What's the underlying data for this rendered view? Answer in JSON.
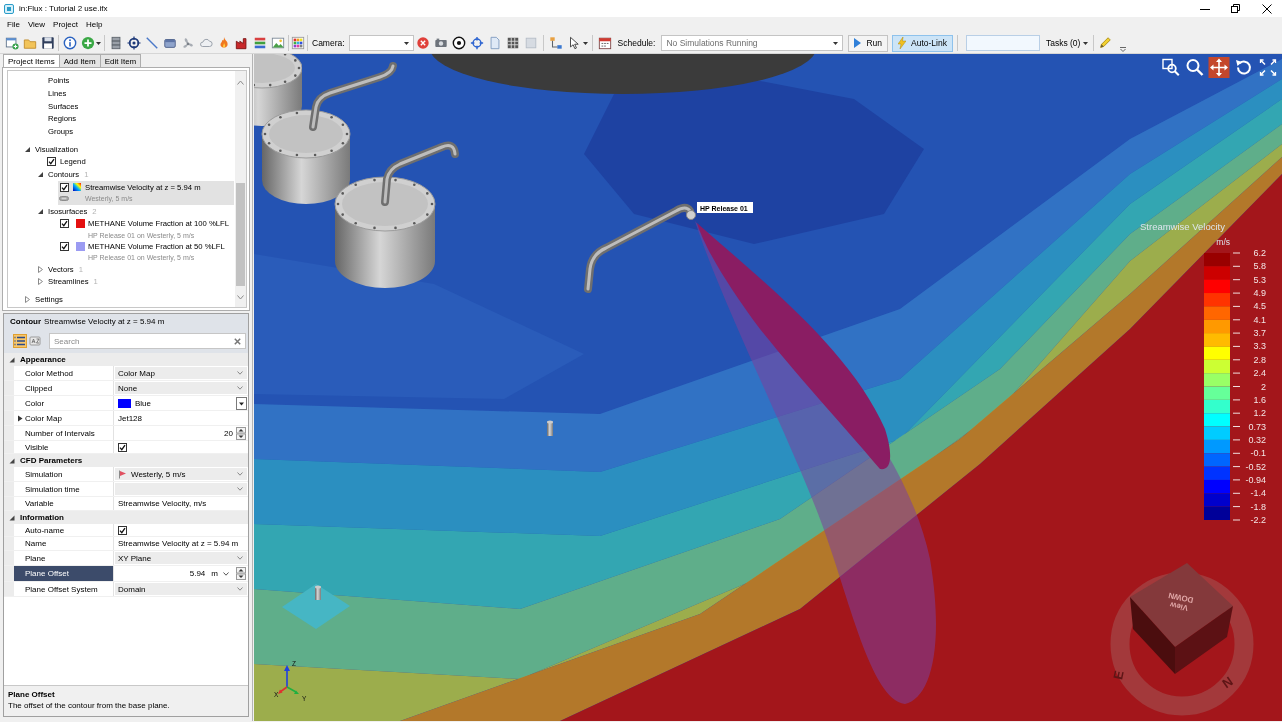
{
  "window": {
    "title": "in:Flux : Tutorial 2 use.ifx"
  },
  "menu": [
    "File",
    "View",
    "Project",
    "Help"
  ],
  "toolbar": {
    "camera_label": "Camera:",
    "schedule_label": "Schedule:",
    "schedule_value": "No Simulations Running",
    "run": "Run",
    "auto_link": {
      "label": "Auto-Link",
      "on": true
    },
    "tasks": "Tasks (0)"
  },
  "tabs": [
    {
      "label": "Project Items",
      "selected": true
    },
    {
      "label": "Add Item",
      "selected": false
    },
    {
      "label": "Edit Item",
      "selected": false
    }
  ],
  "project_tree": {
    "items": [
      {
        "children": [
          {
            "label": "Points",
            "kind": "item",
            "selected": false
          },
          {
            "label": "Lines",
            "kind": "item",
            "selected": false
          },
          {
            "label": "Surfaces",
            "kind": "item",
            "selected": false
          },
          {
            "label": "Regions",
            "kind": "item",
            "selected": false
          },
          {
            "label": "Groups",
            "kind": "item",
            "selected": false
          }
        ]
      },
      {
        "label": "Visualization",
        "kind": "group",
        "expanded": true,
        "selected": false,
        "children": [
          {
            "label": "Legend",
            "kind": "toggle",
            "checked": true,
            "selected": false
          },
          {
            "label": "Contours",
            "kind": "group",
            "count": "1",
            "expanded": true,
            "selected": false,
            "children": [
              {
                "label": "Streamwise Velocity at z = 5.94 m",
                "kind": "contour",
                "detail": "Westerly, 5 m/s",
                "checked": true,
                "selected": true
              }
            ]
          },
          {
            "label": "Isosurfaces",
            "kind": "group",
            "count": "2",
            "expanded": true,
            "selected": false,
            "children": [
              {
                "label": "METHANE Volume Fraction at 100 %LFL",
                "kind": "isosurface",
                "detail": "HP Release 01 on Westerly, 5 m/s",
                "checked": true,
                "color": "#e41010",
                "selected": false
              },
              {
                "label": "METHANE Volume Fraction at 50 %LFL",
                "kind": "isosurface",
                "detail": "HP Release 01 on Westerly, 5 m/s",
                "checked": true,
                "color": "#9b9bf2",
                "selected": false
              }
            ]
          },
          {
            "label": "Vectors",
            "kind": "group",
            "count": "1",
            "expanded": false,
            "selected": false
          },
          {
            "label": "Streamlines",
            "kind": "group",
            "count": "1",
            "expanded": false,
            "selected": false
          }
        ]
      },
      {
        "label": "Settings",
        "kind": "group",
        "expanded": false,
        "selected": false
      }
    ]
  },
  "properties": {
    "header": {
      "type": "Contour",
      "name": "Streamwise Velocity at z = 5.94 m"
    },
    "view_modes": [
      {
        "selected": true
      },
      {
        "selected": false
      }
    ],
    "search": {
      "placeholder": "Search"
    },
    "categories": [
      {
        "label": "Appearance",
        "expanded": true,
        "rows": [
          {
            "label": "Color Method",
            "kind": "dropdown",
            "value": "Color Map",
            "selected": false
          },
          {
            "label": "Clipped",
            "kind": "dropdown",
            "value": "None",
            "selected": false
          },
          {
            "label": "Color",
            "kind": "color",
            "value": "Blue",
            "color": "#0000ff",
            "selected": false
          },
          {
            "label": "Color Map",
            "kind": "expandable",
            "value": "Jet128",
            "expanded": false,
            "selected": false
          },
          {
            "label": "Number of Intervals",
            "kind": "spinner",
            "value": "20",
            "selected": false
          },
          {
            "label": "Visible",
            "kind": "checkbox",
            "checked": true,
            "selected": false
          }
        ]
      },
      {
        "label": "CFD Parameters",
        "expanded": true,
        "rows": [
          {
            "label": "Simulation",
            "kind": "icon_dropdown",
            "value": "Westerly, 5 m/s",
            "selected": false
          },
          {
            "label": "Simulation time",
            "kind": "dropdown",
            "selected": false
          },
          {
            "label": "Variable",
            "kind": "text",
            "value": "Streamwise Velocity, m/s",
            "selected": false
          }
        ]
      },
      {
        "label": "Information",
        "expanded": true,
        "rows": [
          {
            "label": "Auto-name",
            "kind": "checkbox",
            "checked": true,
            "selected": false
          },
          {
            "label": "Name",
            "kind": "text",
            "value": "Streamwise Velocity at z = 5.94 m",
            "selected": false
          },
          {
            "label": "Plane",
            "kind": "dropdown",
            "value": "XY Plane",
            "selected": false
          },
          {
            "label": "Plane Offset",
            "kind": "unit_spinner",
            "value": "5.94",
            "unit": "m",
            "selected": true
          },
          {
            "label": "Plane Offset System",
            "kind": "dropdown",
            "value": "Domain",
            "selected": false
          }
        ]
      }
    ],
    "description": {
      "title": "Plane Offset",
      "text": "The offset of the contour from the base plane."
    }
  },
  "viewport": {
    "tools": [
      {
        "selected": false
      },
      {
        "selected": false
      },
      {
        "selected": true
      },
      {
        "selected": false
      },
      {
        "selected": false
      }
    ],
    "release_label": "HP Release 01",
    "legend": {
      "title": "Streamwise Velocity",
      "unit": "m/s",
      "labels": [
        "6.2",
        "5.8",
        "5.3",
        "4.9",
        "4.5",
        "4.1",
        "3.7",
        "3.3",
        "2.8",
        "2.4",
        "2",
        "1.6",
        "1.2",
        "0.73",
        "0.32",
        "-0.1",
        "-0.52",
        "-0.94",
        "-1.4",
        "-1.8",
        "-2.2"
      ],
      "bands": [
        {
          "color": "#990000"
        },
        {
          "color": "#cc0000"
        },
        {
          "color": "#ff0000"
        },
        {
          "color": "#ff3300"
        },
        {
          "color": "#ff6600"
        },
        {
          "color": "#ff9900"
        },
        {
          "color": "#ffbb00"
        },
        {
          "color": "#ffff00"
        },
        {
          "color": "#ccff33"
        },
        {
          "color": "#99ff66"
        },
        {
          "color": "#66ff99"
        },
        {
          "color": "#33ffcc"
        },
        {
          "color": "#00ffff"
        },
        {
          "color": "#00ccff"
        },
        {
          "color": "#0099ff"
        },
        {
          "color": "#0066ff"
        },
        {
          "color": "#0033ff"
        },
        {
          "color": "#0000ff"
        },
        {
          "color": "#0000cc"
        },
        {
          "color": "#000099"
        }
      ]
    },
    "view_cube": {
      "label": "View DOWN"
    },
    "compass": [
      "E",
      "N"
    ],
    "axes": [
      "Z",
      "X",
      "Y"
    ]
  }
}
